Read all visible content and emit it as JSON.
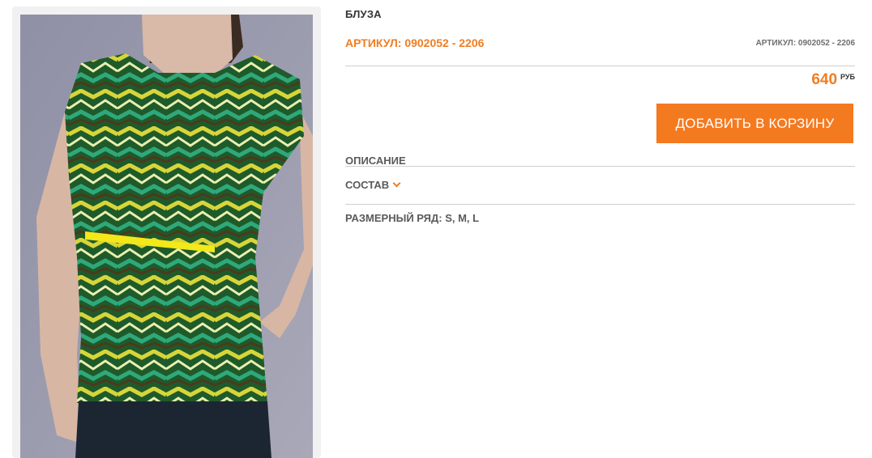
{
  "product": {
    "title": "БЛУЗА",
    "sku_main": "АРТИКУЛ: 0902052 - 2206",
    "sku_small": "АРТИКУЛ: 0902052 - 2206",
    "price": "640",
    "currency": "РУБ",
    "add_to_cart_label": "ДОБАВИТЬ В КОРЗИНУ",
    "description_label": "ОПИСАНИЕ",
    "composition_label": "СОСТАВ",
    "sizes_label": "РАЗМЕРНЫЙ РЯД: S, M, L",
    "image_alt": ""
  },
  "colors": {
    "accent": "#f07d22",
    "button": "#f47a20",
    "text": "#333333",
    "muted": "#5a5a5a"
  },
  "icons": {
    "composition_toggle": "chevron-down-icon"
  }
}
